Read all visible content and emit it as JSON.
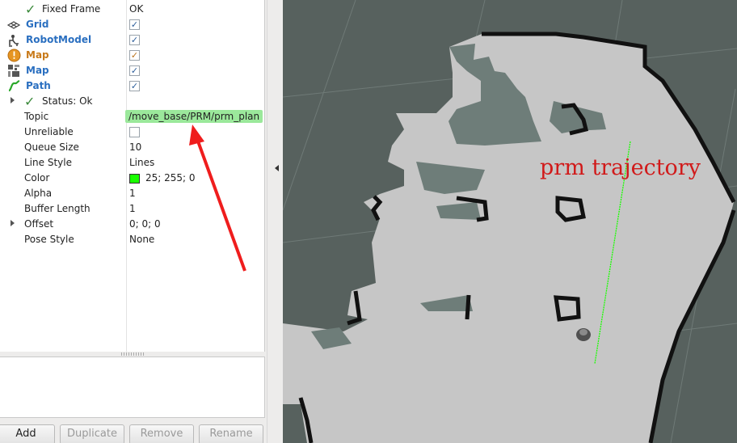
{
  "displays_panel": {
    "rows": {
      "fixed_frame": {
        "name": "Fixed Frame",
        "value": "OK"
      },
      "grid": {
        "name": "Grid"
      },
      "robot_model": {
        "name": "RobotModel"
      },
      "map_warning": {
        "name": "Map"
      },
      "map": {
        "name": "Map"
      },
      "path": {
        "name": "Path"
      },
      "status": {
        "name": "Status: Ok"
      },
      "topic": {
        "name": "Topic",
        "value": "/move_base/PRM/prm_plan"
      },
      "unreliable": {
        "name": "Unreliable"
      },
      "queue_size": {
        "name": "Queue Size",
        "value": "10"
      },
      "line_style": {
        "name": "Line Style",
        "value": "Lines"
      },
      "color": {
        "name": "Color",
        "value": "25; 255; 0",
        "swatch": "#19ff00"
      },
      "alpha": {
        "name": "Alpha",
        "value": "1"
      },
      "buffer_length": {
        "name": "Buffer Length",
        "value": "1"
      },
      "offset": {
        "name": "Offset",
        "value": "0; 0; 0"
      },
      "pose_style": {
        "name": "Pose Style",
        "value": "None"
      }
    },
    "checked_mark": "✓",
    "icons": {
      "ok": "check-icon",
      "grid": "grid-icon",
      "robot_model": "robot-model-icon",
      "map_warning": "warning-icon",
      "map": "map-icon",
      "path": "path-icon"
    }
  },
  "buttons": {
    "add": "Add",
    "duplicate": "Duplicate",
    "remove": "Remove",
    "rename": "Rename"
  },
  "viewport": {
    "annotation": "prm trajectory",
    "colors": {
      "background": "#57615e",
      "map_free": "#c6c6c6",
      "map_unknown": "#6e7d79",
      "obstacle": "#111111",
      "path": "#19ff00",
      "annotation": "#d11a1a"
    }
  }
}
